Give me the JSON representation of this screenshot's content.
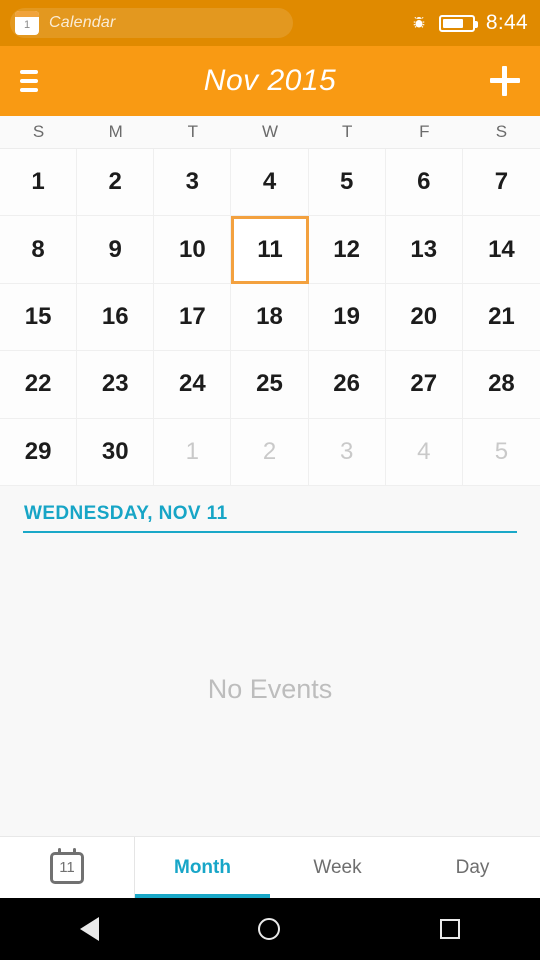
{
  "status_bar": {
    "app_badge_number": "1",
    "app_name": "Calendar",
    "bug_icon": "bug-icon",
    "battery_icon": "battery-icon",
    "time": "8:44"
  },
  "app_bar": {
    "menu_icon": "hamburger-menu-icon",
    "title": "Nov 2015",
    "add_icon": "plus-icon"
  },
  "weekday_headers": [
    "S",
    "M",
    "T",
    "W",
    "T",
    "F",
    "S"
  ],
  "calendar": {
    "month": "Nov",
    "year": "2015",
    "selected_day": "11",
    "days": [
      {
        "label": "1",
        "current_month": true
      },
      {
        "label": "2",
        "current_month": true
      },
      {
        "label": "3",
        "current_month": true
      },
      {
        "label": "4",
        "current_month": true
      },
      {
        "label": "5",
        "current_month": true
      },
      {
        "label": "6",
        "current_month": true
      },
      {
        "label": "7",
        "current_month": true
      },
      {
        "label": "8",
        "current_month": true
      },
      {
        "label": "9",
        "current_month": true
      },
      {
        "label": "10",
        "current_month": true
      },
      {
        "label": "11",
        "current_month": true,
        "selected": true
      },
      {
        "label": "12",
        "current_month": true
      },
      {
        "label": "13",
        "current_month": true
      },
      {
        "label": "14",
        "current_month": true
      },
      {
        "label": "15",
        "current_month": true
      },
      {
        "label": "16",
        "current_month": true
      },
      {
        "label": "17",
        "current_month": true
      },
      {
        "label": "18",
        "current_month": true
      },
      {
        "label": "19",
        "current_month": true
      },
      {
        "label": "20",
        "current_month": true
      },
      {
        "label": "21",
        "current_month": true
      },
      {
        "label": "22",
        "current_month": true
      },
      {
        "label": "23",
        "current_month": true
      },
      {
        "label": "24",
        "current_month": true
      },
      {
        "label": "25",
        "current_month": true
      },
      {
        "label": "26",
        "current_month": true
      },
      {
        "label": "27",
        "current_month": true
      },
      {
        "label": "28",
        "current_month": true
      },
      {
        "label": "29",
        "current_month": true
      },
      {
        "label": "30",
        "current_month": true
      },
      {
        "label": "1",
        "current_month": false
      },
      {
        "label": "2",
        "current_month": false
      },
      {
        "label": "3",
        "current_month": false
      },
      {
        "label": "4",
        "current_month": false
      },
      {
        "label": "5",
        "current_month": false
      }
    ]
  },
  "day_header": {
    "label": "WEDNESDAY, NOV 11"
  },
  "events": {
    "empty_message": "No Events"
  },
  "tab_bar": {
    "calendar_icon": "calendar-day-icon",
    "calendar_icon_number": "11",
    "tabs": [
      {
        "label": "Month",
        "active": true
      },
      {
        "label": "Week",
        "active": false
      },
      {
        "label": "Day",
        "active": false
      }
    ]
  },
  "nav_bar": {
    "back_icon": "back-triangle-icon",
    "home_icon": "home-circle-icon",
    "recents_icon": "recents-square-icon"
  },
  "colors": {
    "status_bar": "#e08a00",
    "app_bar": "#f99a13",
    "accent_teal": "#18a6c8",
    "selection_border": "#f3a13f",
    "day_text": "#1c1c1c",
    "other_month_text": "#c9c9c9",
    "empty_text": "#bdbdbd"
  }
}
